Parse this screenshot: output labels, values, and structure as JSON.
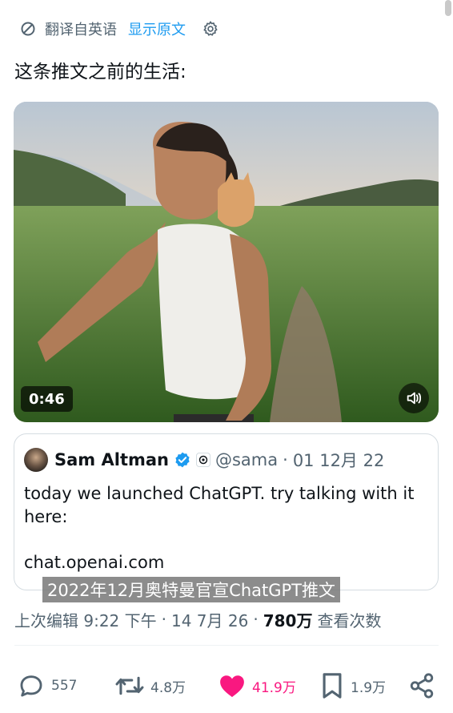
{
  "translate_bar": {
    "translate_label": "翻译自英语",
    "show_original_label": "显示原文",
    "icons": {
      "translate": "no-translate-icon",
      "settings": "gear-icon"
    }
  },
  "tweet": {
    "text": "这条推文之前的生活:",
    "video": {
      "duration": "0:46",
      "volume_icon": "volume-icon"
    },
    "quote": {
      "author_name": "Sam Altman",
      "handle": "@sama",
      "separator": "·",
      "date": "01 12月 22",
      "body": "today we launched ChatGPT. try talking with it here:",
      "link": "chat.openai.com"
    },
    "caption_overlay": "2022年12月奥特曼官宣ChatGPT推文",
    "meta": {
      "last_edited": "上次编辑 9:22 下午",
      "separator": "·",
      "date": "14 7月 26",
      "views_count": "780万",
      "views_label": "查看次数"
    },
    "actions": {
      "reply_count": "557",
      "retweet_count": "4.8万",
      "like_count": "41.9万",
      "bookmark_count": "1.9万"
    }
  },
  "colors": {
    "accent": "#1d9bf0",
    "like": "#f91880",
    "text_primary": "#0f1419",
    "text_secondary": "#536471"
  }
}
